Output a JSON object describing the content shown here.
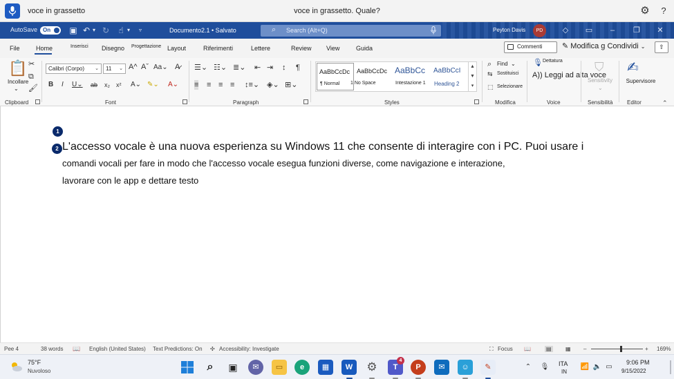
{
  "voice_access": {
    "command_text": "voce in grassetto",
    "feedback_text": "voce in grassetto. Quale?"
  },
  "titlebar": {
    "autosave_label": "AutoSave",
    "autosave_state": "On",
    "document_title": "Documento2.1 • Salvato",
    "search_placeholder": "Search (Alt+Q)",
    "user_name": "Peyton Davis",
    "user_initials": "PD"
  },
  "tabs": [
    {
      "label": "File"
    },
    {
      "label": "Home"
    },
    {
      "label": "Inserisci"
    },
    {
      "label": "Disegno"
    },
    {
      "label": "Progettazione"
    },
    {
      "label": "Layout"
    },
    {
      "label": "Riferimenti"
    },
    {
      "label": "Lettere"
    },
    {
      "label": "Review"
    },
    {
      "label": "View"
    },
    {
      "label": "Guida"
    }
  ],
  "tab_actions": {
    "comments": "Commenti",
    "editing_mode": "Modifica g Condividi"
  },
  "ribbon": {
    "clipboard": {
      "paste": "Incollare",
      "label": "Clipboard"
    },
    "font": {
      "name": "Calibri (Corpo)",
      "size": "11",
      "label": "Font"
    },
    "paragraph": {
      "label": "Paragraph"
    },
    "styles": {
      "label": "Styles",
      "items": [
        {
          "preview": "AaBbCcDc",
          "name": "¶ Normal"
        },
        {
          "preview": "AaBbCcDc",
          "name": "1 No Space"
        },
        {
          "preview": "AaBbCc",
          "name": "Intestazione 1"
        },
        {
          "preview": "AaBbCcI",
          "name": "Heading 2"
        }
      ]
    },
    "editing": {
      "find": "Find",
      "replace": "Sostituisci",
      "select": "Selezionare",
      "label": "Modifica"
    },
    "voice": {
      "dictate": "Dettatura",
      "read_aloud": "A)) Leggi ad alta voce",
      "label": "Voice"
    },
    "sensitivity": {
      "button": "Sensitivity",
      "label": "Sensibilità"
    },
    "editor": {
      "button": "Supervisore",
      "label": "Editor"
    }
  },
  "document": {
    "paragraphs": [
      "L'accesso vocale è una nuova esperienza su Windows 11 che consente di interagire con i PC. Puoi usare i",
      "comandi vocali per fare in modo che l'accesso vocale esegua funzioni diverse, come navigazione e interazione,",
      "lavorare con le app e dettare testo"
    ],
    "overlay_badges": [
      "1",
      "2"
    ]
  },
  "statusbar": {
    "page": "Pee 4",
    "words": "38 words",
    "language": "English (United States)",
    "text_predictions": "Text Predictions: On",
    "accessibility": "Accessibility: Investigate",
    "focus": "Focus",
    "zoom": "169%"
  },
  "taskbar": {
    "weather_temp": "75°F",
    "weather_desc": "Nuvoloso",
    "teams_badge": "4",
    "lang_primary": "ITA",
    "lang_secondary": "IN",
    "time": "9:06 PM",
    "date": "9/15/2022"
  },
  "colors": {
    "title_bar": "#1f4e9c",
    "voice_button": "#1e5bc2",
    "badge": "#0a2a6b",
    "avatar": "#a93b35"
  }
}
